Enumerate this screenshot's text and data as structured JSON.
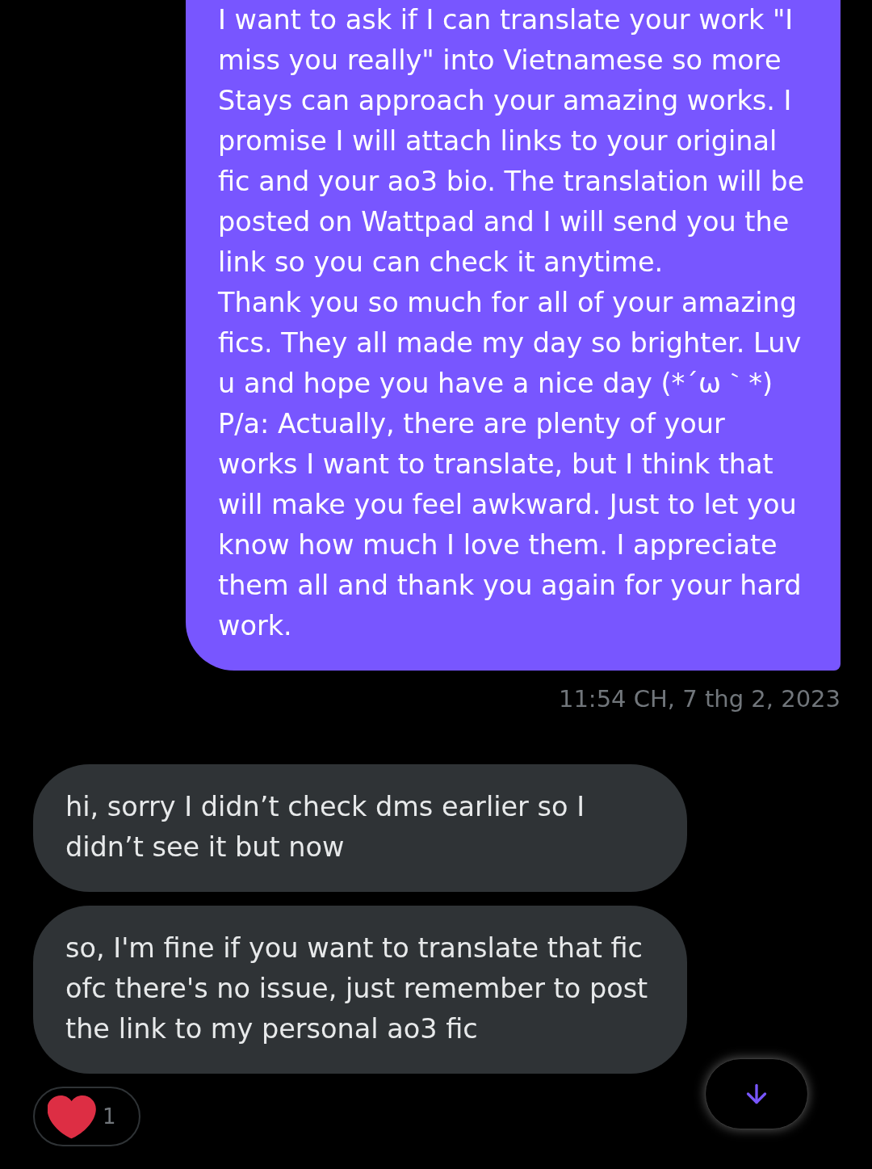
{
  "messages": [
    {
      "kind": "sent",
      "text": "I want to ask if I can translate your work \"I miss you really\" into Vietnamese so more Stays can approach your amazing works. I promise I will attach links to your original fic and your ao3 bio. The translation will be posted on Wattpad and I will send you the link so you can check it anytime.\nThank you so much for all of your amazing fics. They all made my day so brighter. Luv u and hope you have a nice day (*´ω｀*)\nP/a: Actually, there are plenty of your works I want to translate, but I think that will make you feel awkward. Just to let you know how much I love them. I appreciate them all and thank you again for your hard work.",
      "timestamp": "11:54 CH, 7 thg 2, 2023"
    },
    {
      "kind": "received",
      "text": "hi, sorry I didn’t check dms earlier so I didn’t see it but now"
    },
    {
      "kind": "received",
      "text": "so, I'm fine if you want to translate that fic ofc there's no issue, just remember to post the link to my personal ao3 fic",
      "reactions": [
        {
          "count": "1"
        }
      ]
    }
  ]
}
